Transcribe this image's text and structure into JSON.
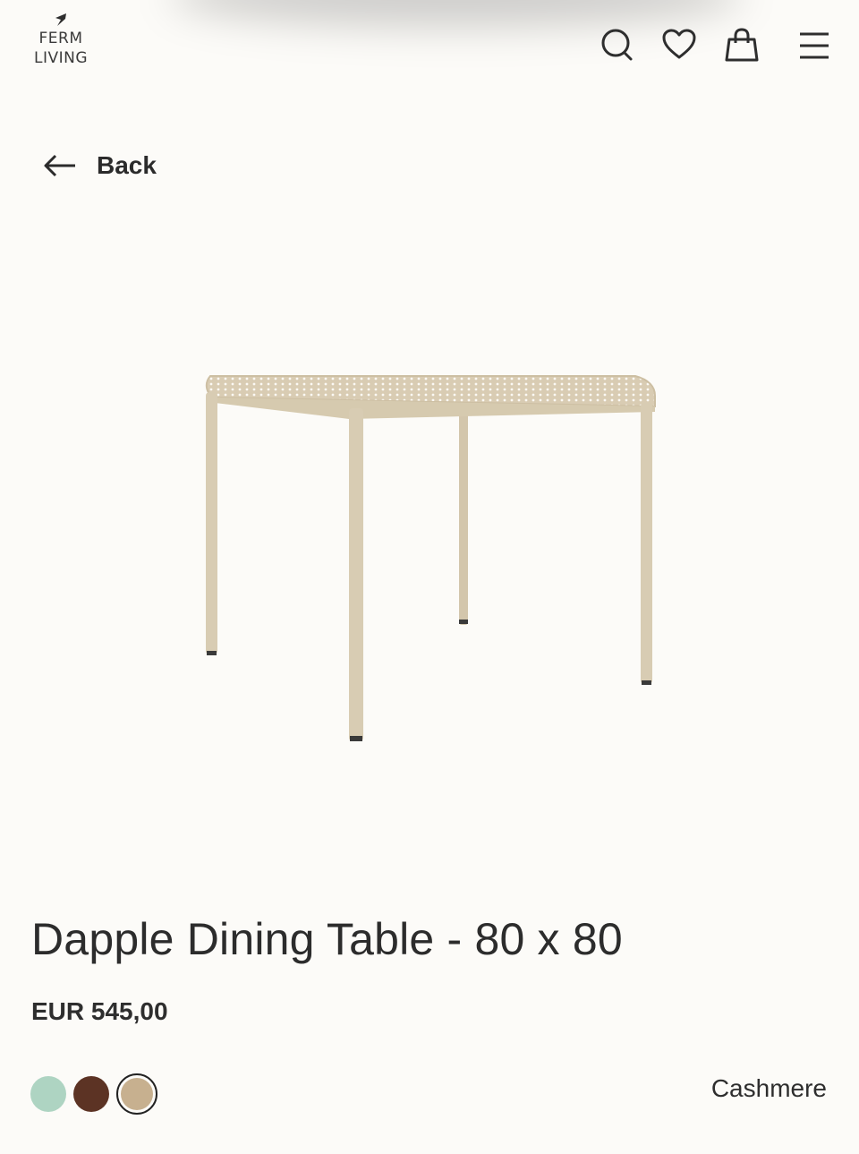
{
  "brand": {
    "line1": "FERM",
    "line2": "LIVING"
  },
  "nav": {
    "icons": [
      "search-icon",
      "heart-icon",
      "bag-icon",
      "menu-icon"
    ]
  },
  "back": {
    "label": "Back"
  },
  "product": {
    "title": "Dapple Dining Table - 80 x 80",
    "price": "EUR 545,00",
    "selected_color": "Cashmere",
    "swatches": [
      {
        "color": "#aed4c2",
        "selected": false
      },
      {
        "color": "#5c3324",
        "selected": false
      },
      {
        "color": "#c7b08f",
        "selected": true
      }
    ]
  },
  "colors": {
    "background": "#fcfbf8",
    "text": "#2e2e2e",
    "table": "#d8ccb3"
  }
}
